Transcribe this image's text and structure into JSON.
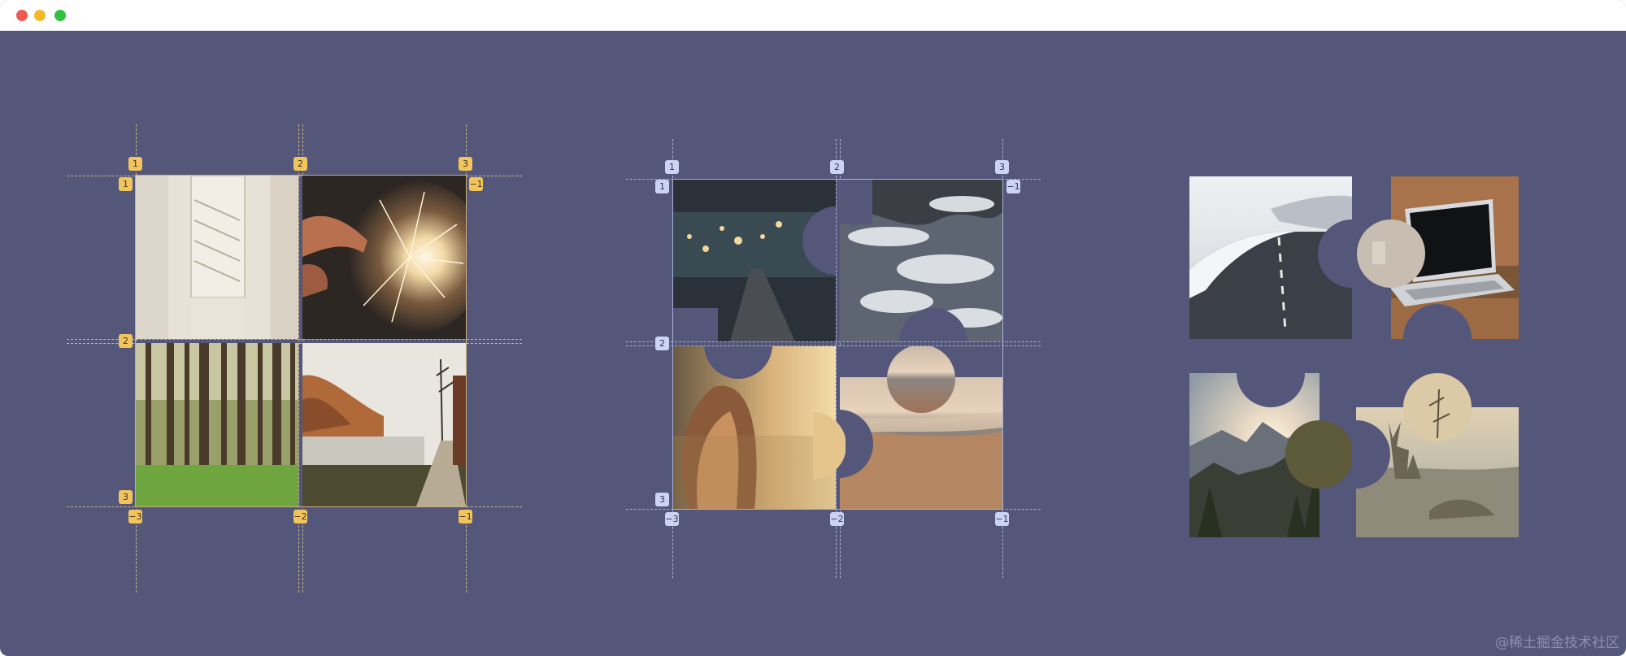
{
  "window": {
    "controls": [
      "close-dot",
      "minimize-dot",
      "zoom-dot"
    ],
    "background_color": "#55577a"
  },
  "grids": [
    {
      "name": "yellow-grid",
      "color": "#f2c45c",
      "line_numbers_top": [
        "1",
        "2",
        "3"
      ],
      "line_numbers_bottom": [
        "−3",
        "−2",
        "−1"
      ],
      "row_numbers_left": [
        "1",
        "2",
        "3"
      ],
      "row_numbers_right": [
        "−1"
      ],
      "start_row_left": "1"
    },
    {
      "name": "blue-grid",
      "color": "#cbd4f2",
      "line_numbers_top": [
        "1",
        "2",
        "3"
      ],
      "line_numbers_bottom": [
        "−3",
        "−2",
        "−1"
      ],
      "row_numbers_left": [
        "1",
        "2",
        "3"
      ],
      "row_numbers_right": [
        "−1"
      ],
      "start_row_left": "1"
    }
  ],
  "images": {
    "grid1": [
      "staircase-photo",
      "sparkler-photo",
      "forest-photo",
      "lake-road-photo"
    ],
    "grid2": [
      "city-lights-photo",
      "ocean-waves-photo",
      "girl-sunset-photo",
      "beach-sunset-photo"
    ],
    "grid3": [
      "snowy-road-photo",
      "laptop-photo",
      "mountain-sunrise-photo",
      "deer-field-photo"
    ]
  },
  "watermark": "@稀土掘金技术社区"
}
